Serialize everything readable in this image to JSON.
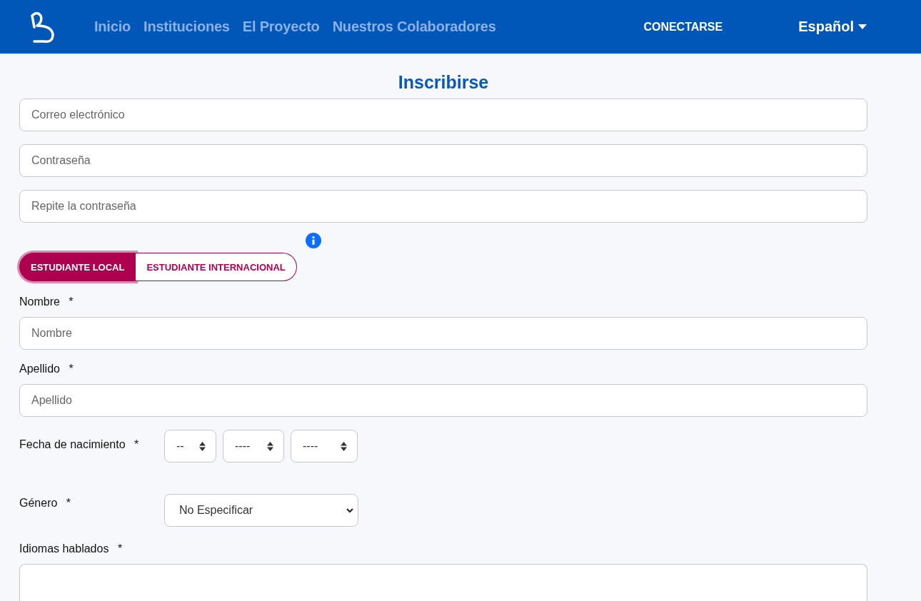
{
  "nav": {
    "links": [
      "Inicio",
      "Instituciones",
      "El Proyecto",
      "Nuestros Colaboradores"
    ],
    "login": "CONECTARSE",
    "language": "Español"
  },
  "form": {
    "title": "Inscribirse",
    "account_fields": [
      {
        "placeholder": "Correo electrónico"
      },
      {
        "placeholder": "Contraseña"
      },
      {
        "placeholder": "Repite la contraseña"
      }
    ],
    "student_type": [
      {
        "label": "ESTUDIANTE LOCAL",
        "selected": true
      },
      {
        "label": "ESTUDIANTE INTERNACIONAL",
        "selected": false
      }
    ],
    "rows": [
      {
        "kind": "text",
        "label": "Nombre",
        "required_mark": "*",
        "placeholder": "Nombre"
      },
      {
        "kind": "text",
        "label": "Apellido",
        "required_mark": "*",
        "placeholder": "Apellido"
      },
      {
        "kind": "date",
        "label": "Fecha de nacimiento",
        "required_mark": "*",
        "selects": [
          "--",
          "----",
          "----"
        ]
      },
      {
        "kind": "select",
        "label": "Género",
        "required_mark": "*",
        "value": "No Especificar"
      },
      {
        "kind": "textarea",
        "label": "Idiomas hablados",
        "required_mark": "*"
      }
    ]
  }
}
